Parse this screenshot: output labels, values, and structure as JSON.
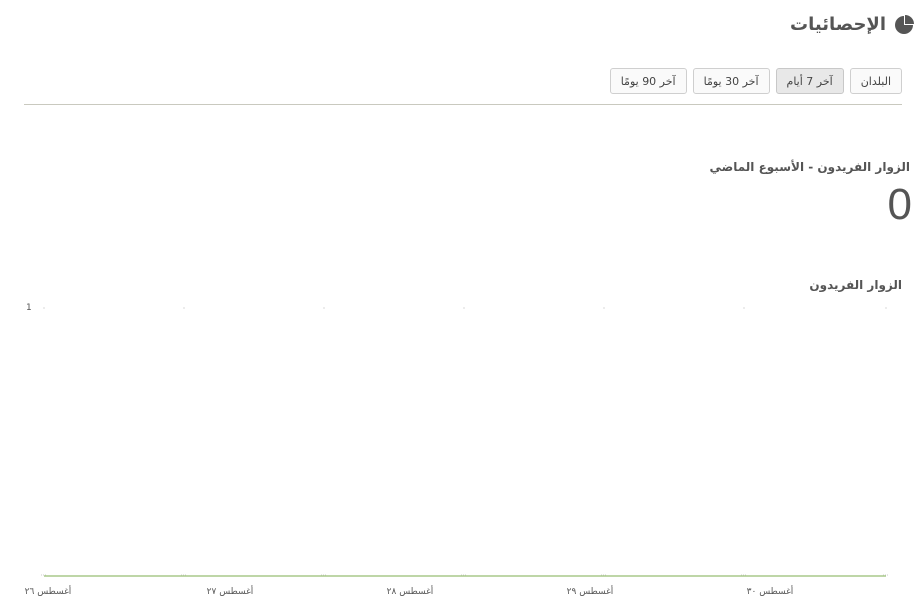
{
  "header": {
    "title": "الإحصائيات",
    "icon": "pie-chart-icon"
  },
  "tabs": [
    {
      "label": "البلدان",
      "active": false
    },
    {
      "label": "آخر 7 أيام",
      "active": true
    },
    {
      "label": "آخر 30 يومًا",
      "active": false
    },
    {
      "label": "آخر 90 يومًا",
      "active": false
    }
  ],
  "stat": {
    "label": "الزوار الفريدون - الأسبوع الماضي",
    "value": "0"
  },
  "chart_data": {
    "type": "line",
    "title": "الزوار الفريدون",
    "x": [
      "أغسطس ٢٦",
      "أغسطس ٢٧",
      "أغسطس ٢٨",
      "أغسطس ٢٩",
      "أغسطس ٣٠",
      ""
    ],
    "series": [
      {
        "values": [
          0,
          0,
          0,
          0,
          0,
          0,
          0
        ]
      }
    ],
    "ylim": [
      0,
      1
    ],
    "yticks": [
      "1"
    ],
    "line_color": "#a8c98a",
    "grid": true
  }
}
